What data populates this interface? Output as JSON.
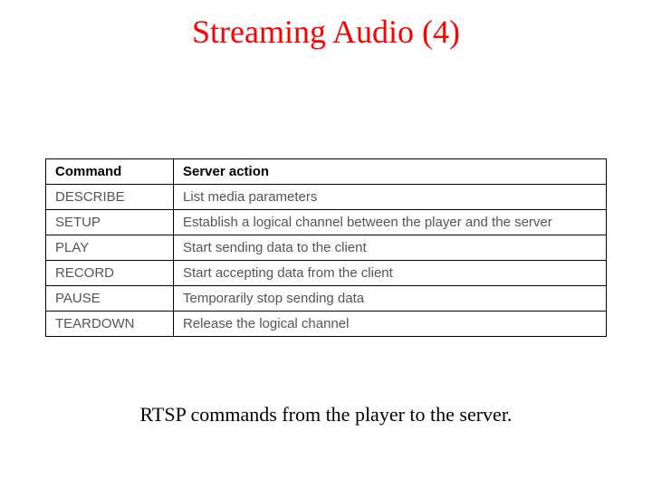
{
  "title": "Streaming Audio (4)",
  "table": {
    "headers": {
      "command": "Command",
      "action": "Server action"
    },
    "rows": [
      {
        "command": "DESCRIBE",
        "action": "List media parameters"
      },
      {
        "command": "SETUP",
        "action": "Establish a logical channel between the player and the server"
      },
      {
        "command": "PLAY",
        "action": "Start sending data to the client"
      },
      {
        "command": "RECORD",
        "action": "Start accepting data from the client"
      },
      {
        "command": "PAUSE",
        "action": "Temporarily stop sending data"
      },
      {
        "command": "TEARDOWN",
        "action": "Release the logical channel"
      }
    ]
  },
  "caption": "RTSP commands from the player to the server."
}
